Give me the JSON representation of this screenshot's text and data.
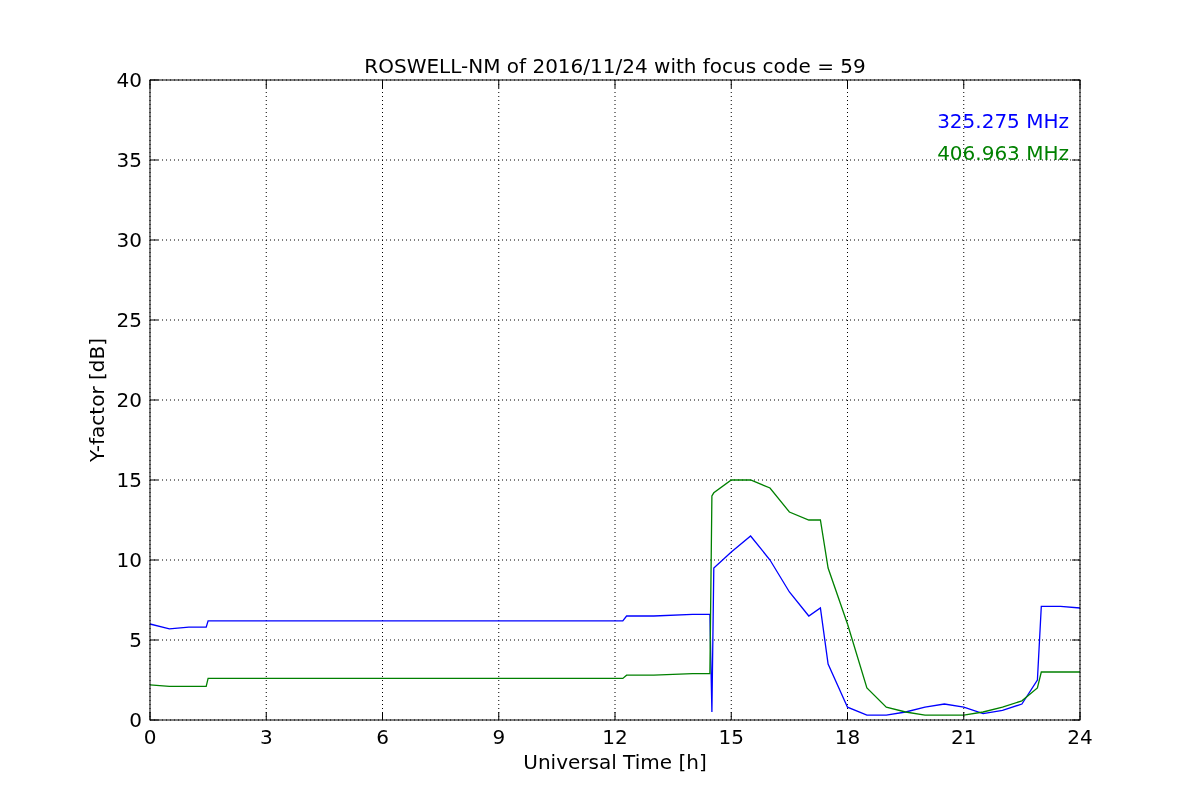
{
  "figure": {
    "chart_data": {
      "type": "line",
      "title": "ROSWELL-NM of 2016/11/24 with focus code = 59",
      "xlabel": "Universal Time [h]",
      "ylabel": "Y-factor [dB]",
      "x": [
        0,
        0.5,
        1,
        1.45,
        1.5,
        3,
        6,
        9,
        12.2,
        12.3,
        13,
        14,
        14.45,
        14.5,
        14.55,
        15,
        15.5,
        16,
        16.5,
        17,
        17.3,
        17.5,
        18,
        18.5,
        19,
        19.5,
        20,
        20.5,
        21,
        21.5,
        22,
        22.5,
        22.9,
        23,
        23.5,
        24
      ],
      "series": [
        {
          "name": "325.275 MHz",
          "color": "#0000ff",
          "values": [
            6.0,
            5.7,
            5.8,
            5.8,
            6.2,
            6.2,
            6.2,
            6.2,
            6.2,
            6.5,
            6.5,
            6.6,
            6.6,
            0.5,
            9.5,
            10.5,
            11.5,
            10.0,
            8.0,
            6.5,
            7.0,
            3.5,
            0.8,
            0.3,
            0.3,
            0.5,
            0.8,
            1.0,
            0.8,
            0.4,
            0.6,
            1.0,
            2.5,
            7.1,
            7.1,
            7.0
          ]
        },
        {
          "name": "406.963 MHz",
          "color": "#008000",
          "values": [
            2.2,
            2.1,
            2.1,
            2.1,
            2.6,
            2.6,
            2.6,
            2.6,
            2.6,
            2.8,
            2.8,
            2.9,
            2.9,
            14.0,
            14.2,
            15.0,
            15.0,
            14.5,
            13.0,
            12.5,
            12.5,
            9.5,
            6.0,
            2.0,
            0.8,
            0.5,
            0.3,
            0.3,
            0.3,
            0.5,
            0.8,
            1.2,
            2.0,
            3.0,
            3.0,
            3.0
          ]
        }
      ],
      "grid": true,
      "xlim": [
        0,
        24
      ],
      "ylim": [
        0,
        40
      ],
      "xticks": [
        0,
        3,
        6,
        9,
        12,
        15,
        18,
        21,
        24
      ],
      "yticks": [
        0,
        5,
        10,
        15,
        20,
        25,
        30,
        35,
        40
      ]
    }
  }
}
